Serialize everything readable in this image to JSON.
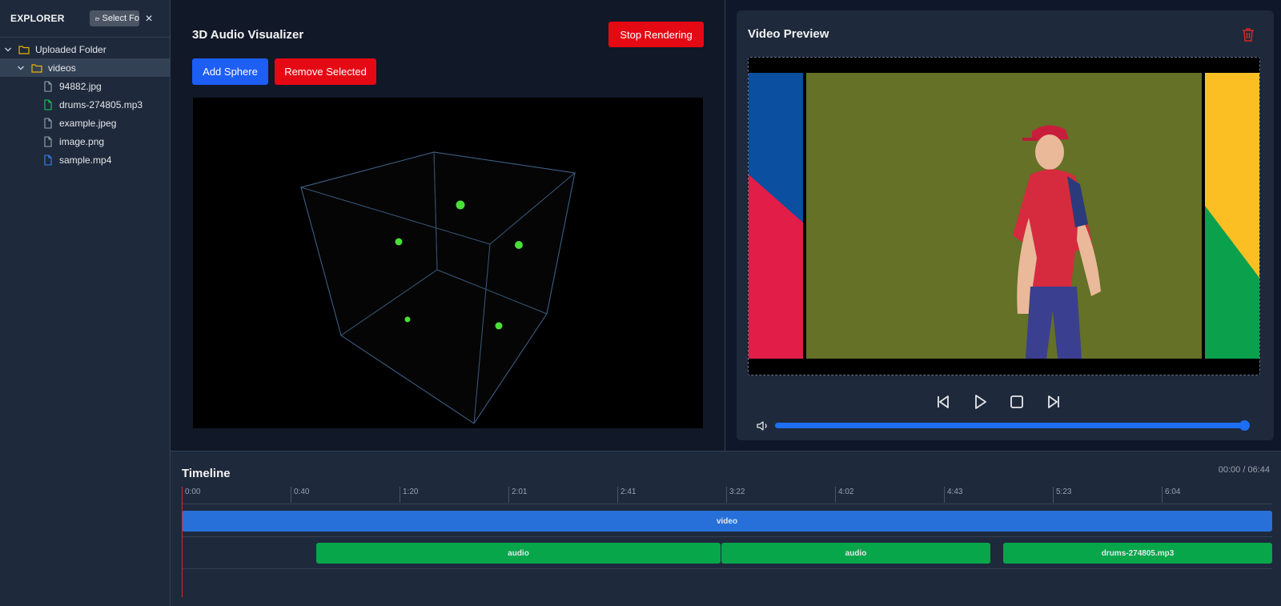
{
  "explorer": {
    "title": "EXPLORER",
    "select_folder_label": "Select Fo",
    "close_glyph": "×",
    "tree": [
      {
        "label": "Uploaded Folder",
        "type": "folder",
        "level": 0
      },
      {
        "label": "videos",
        "type": "folder",
        "level": 1,
        "selected": true
      },
      {
        "label": "94882.jpg",
        "type": "image",
        "level": 2
      },
      {
        "label": "drums-274805.mp3",
        "type": "audio",
        "level": 2
      },
      {
        "label": "example.jpeg",
        "type": "image",
        "level": 2
      },
      {
        "label": "image.png",
        "type": "image",
        "level": 2
      },
      {
        "label": "sample.mp4",
        "type": "video",
        "level": 2
      }
    ]
  },
  "visualizer": {
    "title": "3D Audio Visualizer",
    "stop_label": "Stop Rendering",
    "add_label": "Add Sphere",
    "remove_label": "Remove Selected"
  },
  "preview": {
    "title": "Video Preview",
    "volume_progress": 1.0
  },
  "timeline": {
    "title": "Timeline",
    "time_display": "00:00 / 06:44",
    "ticks": [
      "0:00",
      "0:40",
      "1:20",
      "2:01",
      "2:41",
      "3:22",
      "4:02",
      "4:43",
      "5:23",
      "6:04"
    ],
    "video_clip_label": "video",
    "audio_clips": [
      "audio",
      "audio",
      "drums-274805.mp3"
    ]
  },
  "colors": {
    "accent_blue": "#1d5ef5",
    "danger_red": "#e50914",
    "clip_video": "#2870d9",
    "clip_audio": "#07a64a",
    "sphere_green": "#4ade3a"
  }
}
